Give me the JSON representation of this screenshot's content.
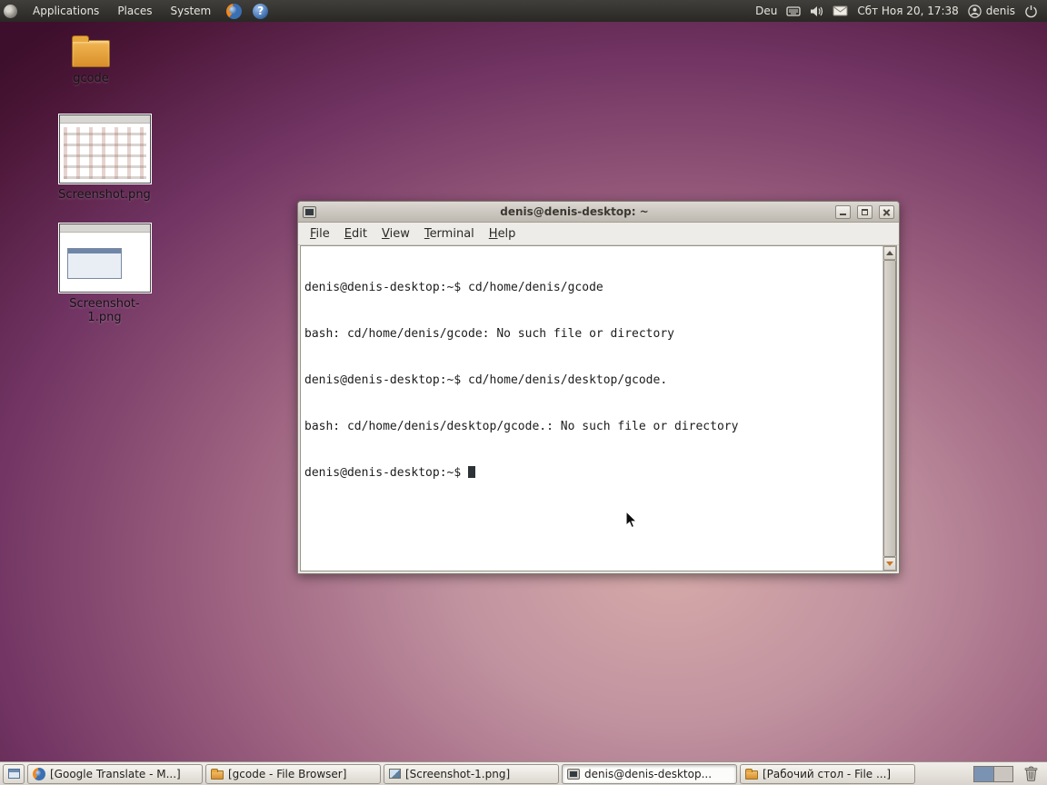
{
  "top_panel": {
    "menus": [
      {
        "label": "Applications"
      },
      {
        "label": "Places"
      },
      {
        "label": "System"
      }
    ],
    "icons": {
      "help_glyph": "?"
    },
    "keyboard_layout": "Deu",
    "clock": "Сбт Ноя 20, 17:38",
    "username": "denis"
  },
  "desktop": {
    "icons": [
      {
        "label": "gcode",
        "type": "folder"
      },
      {
        "label": "Screenshot.png",
        "type": "image"
      },
      {
        "label": "Screenshot-1.png",
        "type": "image"
      }
    ]
  },
  "terminal_window": {
    "title": "denis@denis-desktop: ~",
    "menu": [
      {
        "label": "File"
      },
      {
        "label": "Edit"
      },
      {
        "label": "View"
      },
      {
        "label": "Terminal"
      },
      {
        "label": "Help"
      }
    ],
    "lines": [
      "denis@denis-desktop:~$ cd/home/denis/gcode",
      "bash: cd/home/denis/gcode: No such file or directory",
      "denis@denis-desktop:~$ cd/home/denis/desktop/gcode.",
      "bash: cd/home/denis/desktop/gcode.: No such file or directory",
      "denis@denis-desktop:~$ "
    ]
  },
  "taskbar": {
    "tasks": [
      {
        "label": "[Google Translate - M...]",
        "icon": "firefox",
        "active": false
      },
      {
        "label": "[gcode - File Browser]",
        "icon": "folder",
        "active": false
      },
      {
        "label": "[Screenshot-1.png]",
        "icon": "image",
        "active": false
      },
      {
        "label": "denis@denis-desktop...",
        "icon": "terminal",
        "active": true
      },
      {
        "label": "[Рабочий стол - File ...]",
        "icon": "folder",
        "active": false
      }
    ],
    "workspaces": {
      "count": 2,
      "active_index": 0
    }
  },
  "colors": {
    "panel_bg": "#2c2b28",
    "wallpaper_light": "#d6aaa9",
    "wallpaper_dark": "#3d0f2c",
    "folder_orange": "#e9a83d",
    "workspace_active": "#7b93b3",
    "taskbar_bg": "#e3dfd8"
  }
}
